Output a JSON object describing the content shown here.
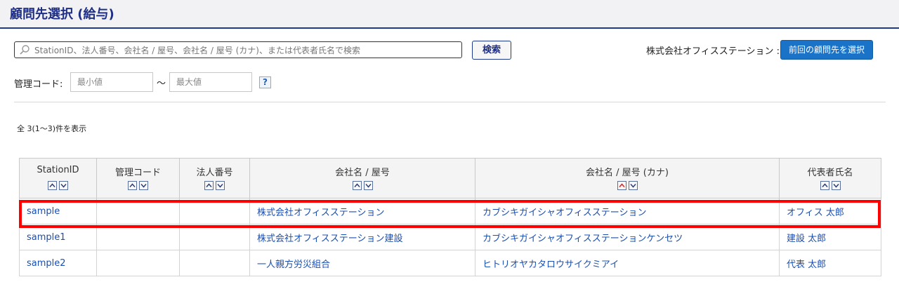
{
  "header": {
    "title": "顧問先選択 (給与)"
  },
  "search": {
    "placeholder": "StationID、法人番号、会社名 / 屋号、会社名 / 屋号 (カナ)、または代表者氏名で検索",
    "button_label": "検索"
  },
  "company": {
    "label": "株式会社オフィスステーション :",
    "prev_button": "前回の顧問先を選択"
  },
  "filter": {
    "code_label": "管理コード:",
    "min_placeholder": "最小値",
    "range_sep": "〜",
    "max_placeholder": "最大値",
    "help": "?"
  },
  "result": {
    "count_text": "全 3(1〜3)件を表示"
  },
  "table": {
    "columns": [
      "StationID",
      "管理コード",
      "法人番号",
      "会社名 / 屋号",
      "会社名 / 屋号 (カナ)",
      "代表者氏名"
    ],
    "rows": [
      [
        "sample",
        "",
        "",
        "株式会社オフィスステーション",
        "カブシキガイシャオフィスステーション",
        "オフィス 太郎"
      ],
      [
        "sample1",
        "",
        "",
        "株式会社オフィスステーション建設",
        "カブシキガイシャオフィスステーションケンセツ",
        "建設 太郎"
      ],
      [
        "sample2",
        "",
        "",
        "一人親方労災組合",
        "ヒトリオヤカタロウサイクミアイ",
        "代表 太郎"
      ]
    ],
    "active_sort": {
      "column": 4,
      "direction": "asc",
      "color": "#e02020"
    }
  },
  "colors": {
    "accent": "#1f2f86",
    "primary_button": "#1b73c8",
    "link": "#1a4fb0",
    "highlight": "#ff0000"
  }
}
